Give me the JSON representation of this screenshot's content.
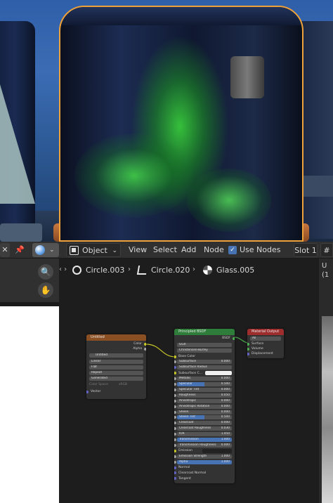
{
  "header": {
    "close_glyph": "✕",
    "pin_glyph": "📌",
    "shading_chevron": "⌄",
    "object_mode": "Object",
    "object_chevron": "⌄",
    "menus": [
      "View",
      "Select",
      "Add",
      "Node"
    ],
    "use_nodes_label": "Use Nodes",
    "use_nodes_checked": true,
    "slot_label": "Slot 1",
    "hash": "#"
  },
  "tools": {
    "zoom_glyph": "🔍",
    "hand_glyph": "✋",
    "arrows": "‹ ›"
  },
  "breadcrumb": {
    "object_name": "Circle.003",
    "mesh_name": "Circle.020",
    "material_name": "Glass.005",
    "separator": "›"
  },
  "node_image_texture": {
    "title": "Untitled",
    "out_color": "Color",
    "out_alpha": "Alpha",
    "image_name": "Untitled",
    "interpolation": "Linear",
    "projection": "Flat",
    "extension": "Repeat",
    "source": "Generated",
    "color_space_label": "Color Space",
    "color_space_value": "sRGB",
    "in_vector": "Vector"
  },
  "node_principled": {
    "title": "Principled BSDF",
    "out_bsdf": "BSDF",
    "distribution": "GGX",
    "subsurface_method": "Christensen-Burley",
    "inputs": [
      {
        "label": "Base Color",
        "kind": "socket",
        "color": "#c7c729"
      },
      {
        "label": "Subsurface",
        "kind": "value",
        "value": "0.000",
        "color": "#a1a1a1"
      },
      {
        "label": "Subsurface Radius",
        "kind": "dropdown",
        "color": "#6363c7"
      },
      {
        "label": "Subsurface C...",
        "kind": "color",
        "color": "#c7c729"
      },
      {
        "label": "Metallic",
        "kind": "value",
        "value": "0.000",
        "color": "#a1a1a1"
      },
      {
        "label": "Specular",
        "kind": "bar",
        "value": "0.500",
        "color": "#a1a1a1"
      },
      {
        "label": "Specular Tint",
        "kind": "value",
        "value": "0.000",
        "color": "#a1a1a1"
      },
      {
        "label": "Roughness",
        "kind": "value",
        "value": "0.050",
        "color": "#a1a1a1"
      },
      {
        "label": "Anisotropic",
        "kind": "value",
        "value": "0.000",
        "color": "#a1a1a1"
      },
      {
        "label": "Anisotropic Rotation",
        "kind": "value",
        "value": "0.000",
        "color": "#a1a1a1"
      },
      {
        "label": "Sheen",
        "kind": "value",
        "value": "0.000",
        "color": "#a1a1a1"
      },
      {
        "label": "Sheen Tint",
        "kind": "bar",
        "value": "0.500",
        "color": "#a1a1a1"
      },
      {
        "label": "Clearcoat",
        "kind": "value",
        "value": "0.000",
        "color": "#a1a1a1"
      },
      {
        "label": "Clearcoat Roughness",
        "kind": "value",
        "value": "0.030",
        "color": "#a1a1a1"
      },
      {
        "label": "IOR",
        "kind": "value",
        "value": "1.450",
        "color": "#a1a1a1"
      },
      {
        "label": "Transmission",
        "kind": "full",
        "value": "1.000",
        "color": "#a1a1a1"
      },
      {
        "label": "Transmission Roughness",
        "kind": "value",
        "value": "0.000",
        "color": "#a1a1a1"
      },
      {
        "label": "Emission",
        "kind": "dark",
        "color": "#c7c729"
      },
      {
        "label": "Emission Strength",
        "kind": "value",
        "value": "1.000",
        "color": "#a1a1a1"
      },
      {
        "label": "Alpha",
        "kind": "full",
        "value": "1.000",
        "color": "#a1a1a1"
      },
      {
        "label": "Normal",
        "kind": "socket",
        "color": "#6363c7"
      },
      {
        "label": "Clearcoat Normal",
        "kind": "socket",
        "color": "#6363c7"
      },
      {
        "label": "Tangent",
        "kind": "socket",
        "color": "#6363c7"
      }
    ]
  },
  "node_output": {
    "title": "Material Output",
    "target": "All",
    "surface": "Surface",
    "volume": "Volume",
    "displacement": "Displacement"
  },
  "right_panel": {
    "line1": "U",
    "line2": "(1"
  },
  "colors": {
    "accent_blue": "#4772b3",
    "texture_header": "#8a4f23",
    "shader_header": "#2e7d3a",
    "output_header": "#9e2e2e",
    "selection_outline": "#f0a23a"
  }
}
